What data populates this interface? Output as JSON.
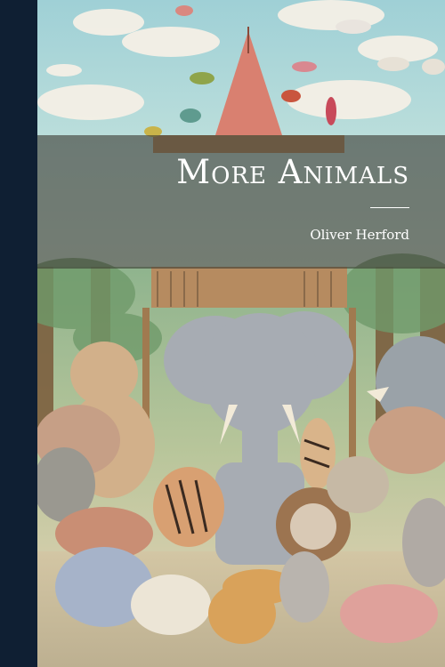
{
  "book": {
    "title": "More Animals",
    "author": "Oliver Herford"
  },
  "colors": {
    "spine": "#0f1f33",
    "title_band": "rgba(60,60,52,0.62)",
    "text": "#ffffff"
  }
}
